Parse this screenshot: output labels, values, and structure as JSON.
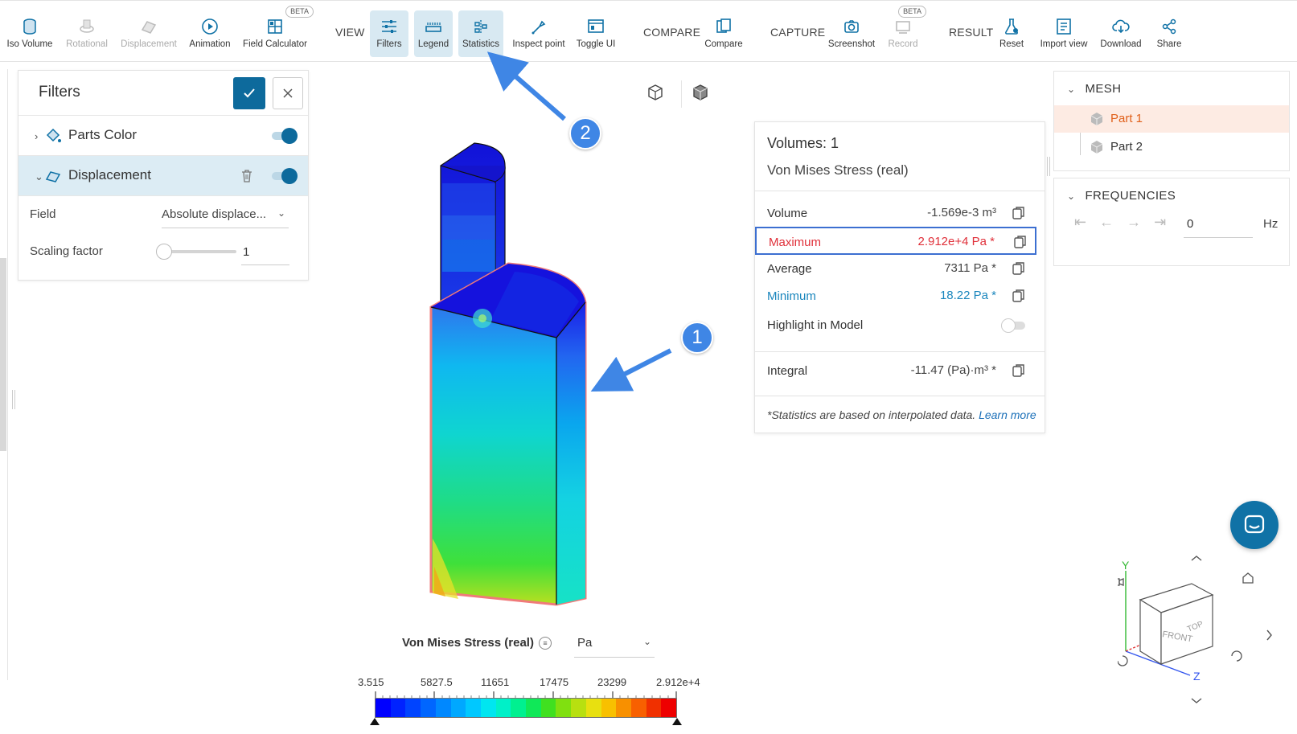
{
  "toolbar": {
    "items": [
      {
        "label": "Iso Volume",
        "icon": "iso-volume-icon",
        "disabled": false
      },
      {
        "label": "Rotational",
        "icon": "rotational-icon",
        "disabled": true
      },
      {
        "label": "Displacement",
        "icon": "displacement-icon",
        "disabled": true
      },
      {
        "label": "Animation",
        "icon": "play-icon",
        "disabled": false
      },
      {
        "label": "Field Calculator",
        "icon": "calculator-icon",
        "disabled": false,
        "badge": "BETA"
      }
    ],
    "view_group": "VIEW",
    "view_items": [
      {
        "label": "Filters",
        "icon": "filters-icon",
        "active": true
      },
      {
        "label": "Legend",
        "icon": "legend-icon",
        "active": true
      },
      {
        "label": "Statistics",
        "icon": "statistics-icon",
        "active": true
      },
      {
        "label": "Inspect point",
        "icon": "inspect-icon",
        "active": false
      },
      {
        "label": "Toggle UI",
        "icon": "toggle-ui-icon",
        "active": false
      }
    ],
    "compare_group": "COMPARE",
    "compare_label": "Compare",
    "capture_group": "CAPTURE",
    "screenshot_label": "Screenshot",
    "record_label": "Record",
    "record_badge": "BETA",
    "result_group": "RESULT",
    "reset_label": "Reset",
    "import_view_label": "Import view",
    "download_label": "Download",
    "share_label": "Share"
  },
  "filters": {
    "title": "Filters",
    "items": [
      {
        "label": "Parts Color",
        "expanded": false,
        "enabled": true
      },
      {
        "label": "Displacement",
        "expanded": true,
        "enabled": true
      }
    ],
    "field_label": "Field",
    "field_value": "Absolute displace...",
    "scaling_label": "Scaling factor",
    "scaling_value": "1"
  },
  "callouts": {
    "one": "1",
    "two": "2"
  },
  "statistics": {
    "title": "Volumes: 1",
    "subtitle": "Von Mises Stress (real)",
    "volume_label": "Volume",
    "volume_value": "-1.569e-3 m³",
    "maximum_label": "Maximum",
    "maximum_value": "2.912e+4 Pa *",
    "average_label": "Average",
    "average_value": "7311 Pa *",
    "minimum_label": "Minimum",
    "minimum_value": "18.22 Pa *",
    "highlight_label": "Highlight in Model",
    "integral_label": "Integral",
    "integral_value": "-11.47 (Pa)·m³ *",
    "note": "*Statistics are based on interpolated data.",
    "learn_more": "Learn more",
    "colors": {
      "maximum": "#e0303a",
      "minimum": "#1a86bd",
      "highlight_border": "#3c6fd1"
    }
  },
  "mesh": {
    "title": "MESH",
    "parts": [
      {
        "label": "Part 1",
        "selected": true
      },
      {
        "label": "Part 2",
        "selected": false
      }
    ]
  },
  "frequencies": {
    "title": "FREQUENCIES",
    "value": "0",
    "unit": "Hz"
  },
  "legend": {
    "title": "Von Mises Stress (real)",
    "menu_icon": "≡",
    "unit": "Pa",
    "ticks": [
      "3.515",
      "5827.5",
      "11651",
      "17475",
      "23299",
      "2.912e+4"
    ]
  },
  "navcube": {
    "front": "FRONT",
    "top": "TOP",
    "axis_x": "X",
    "axis_y": "Y",
    "axis_z": "Z"
  },
  "accent": "#0d6a9c"
}
